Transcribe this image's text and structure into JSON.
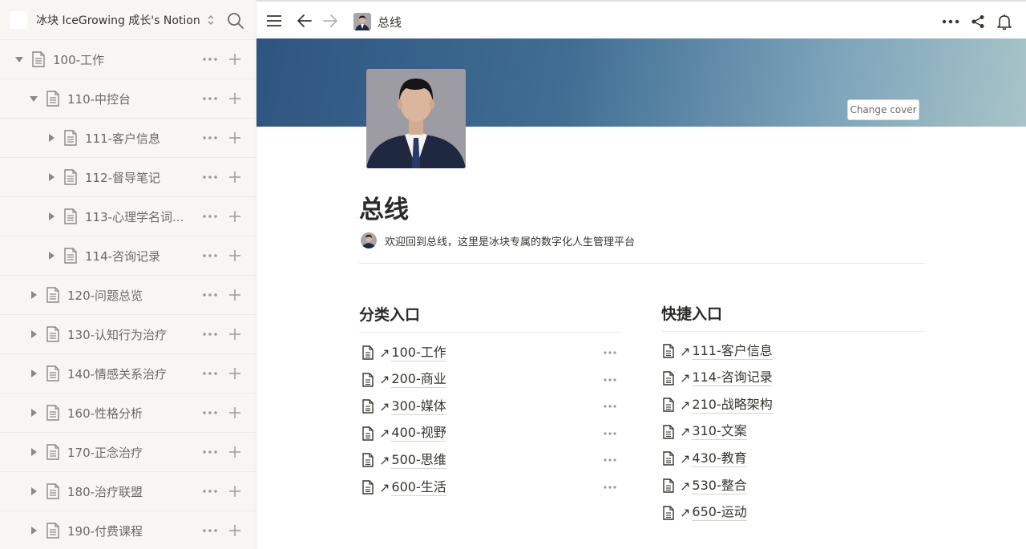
{
  "workspace": {
    "name": "冰块 IceGrowing 成长's Notion"
  },
  "sidebar": {
    "items": [
      {
        "label": "100-工作",
        "expanded": true
      },
      {
        "label": "110-中控台",
        "expanded": true
      },
      {
        "label": "111-客户信息",
        "expanded": false
      },
      {
        "label": "112-督导笔记",
        "expanded": false
      },
      {
        "label": "113-心理学名词...",
        "expanded": false
      },
      {
        "label": "114-咨询记录",
        "expanded": false
      },
      {
        "label": "120-问题总览",
        "expanded": false
      },
      {
        "label": "130-认知行为治疗",
        "expanded": false
      },
      {
        "label": "140-情感关系治疗",
        "expanded": false
      },
      {
        "label": "160-性格分析",
        "expanded": false
      },
      {
        "label": "170-正念治疗",
        "expanded": false
      },
      {
        "label": "180-治疗联盟",
        "expanded": false
      },
      {
        "label": "190-付费课程",
        "expanded": false
      }
    ]
  },
  "topbar": {
    "breadcrumb": "总线"
  },
  "cover": {
    "change_label": "Change cover"
  },
  "page": {
    "title": "总线",
    "callout": "欢迎回到总线，这里是冰块专属的数字化人生管理平台",
    "left_column": {
      "title": "分类入口",
      "links": [
        "100-工作",
        "200-商业",
        "300-媒体",
        "400-视野",
        "500-思维",
        "600-生活"
      ]
    },
    "right_column": {
      "title": "快捷入口",
      "links": [
        "111-客户信息",
        "114-咨询记录",
        "210-战略架构",
        "310-文案",
        "430-教育",
        "530-整合",
        "650-运动"
      ]
    },
    "link_arrow": "↗"
  },
  "colors": {
    "sidebar_bg": "#f7f6f3",
    "text": "#37352f",
    "muted": "#6b6a67",
    "cover_start": "#2e5580",
    "cover_end": "#a8c4c8"
  }
}
